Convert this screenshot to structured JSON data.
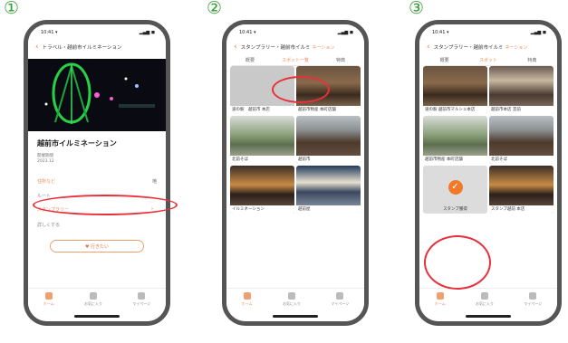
{
  "steps": {
    "one": "①",
    "two": "②",
    "three": "③"
  },
  "status": {
    "time": "10:41 ▾",
    "signal": "▂▄▆ ◼"
  },
  "phone1": {
    "title": "トラベル・越前市イルミネーション",
    "event_title": "越前市イルミネーション",
    "meta1": "開催期間",
    "meta2": "2023.12",
    "row1_label": "住所など",
    "row1_value": "地",
    "row2_label": "ルート",
    "row3_label": "スタンプラリー",
    "row3_chevron": "›",
    "row4_label": "詳しくする",
    "fav_button": "♥ 行きたい"
  },
  "phone2": {
    "title": "スタンプラリー・越前市イルミ",
    "title_sub": "ネーション",
    "tabs": [
      "概要",
      "スポット一覧",
      "特典"
    ],
    "cells": [
      "道の駅　越前市 本店",
      "越前市物産 本町店舗",
      "北前そば",
      "越前市",
      "イルミネーション",
      "越前屋"
    ]
  },
  "phone3": {
    "title": "スタンプラリー・越前市イルミ",
    "title_sub": "ネーション",
    "tabs": [
      "概要",
      "スポット",
      "特典"
    ],
    "cells": [
      "道の駅 越前市マルシェ本店",
      "越前市本店 宮前",
      "越前市物産 本町店舗",
      "北前そば",
      "スタンプ獲得",
      "スタンプ越前 本店"
    ],
    "stamp_caption": "スタンプ獲得"
  },
  "bottom_nav": [
    "ホーム",
    "お気に入り",
    "マイページ"
  ],
  "colors": {
    "accent": "#f08a5d",
    "highlight": "#e8303a",
    "step_number": "#2f9c2f"
  }
}
